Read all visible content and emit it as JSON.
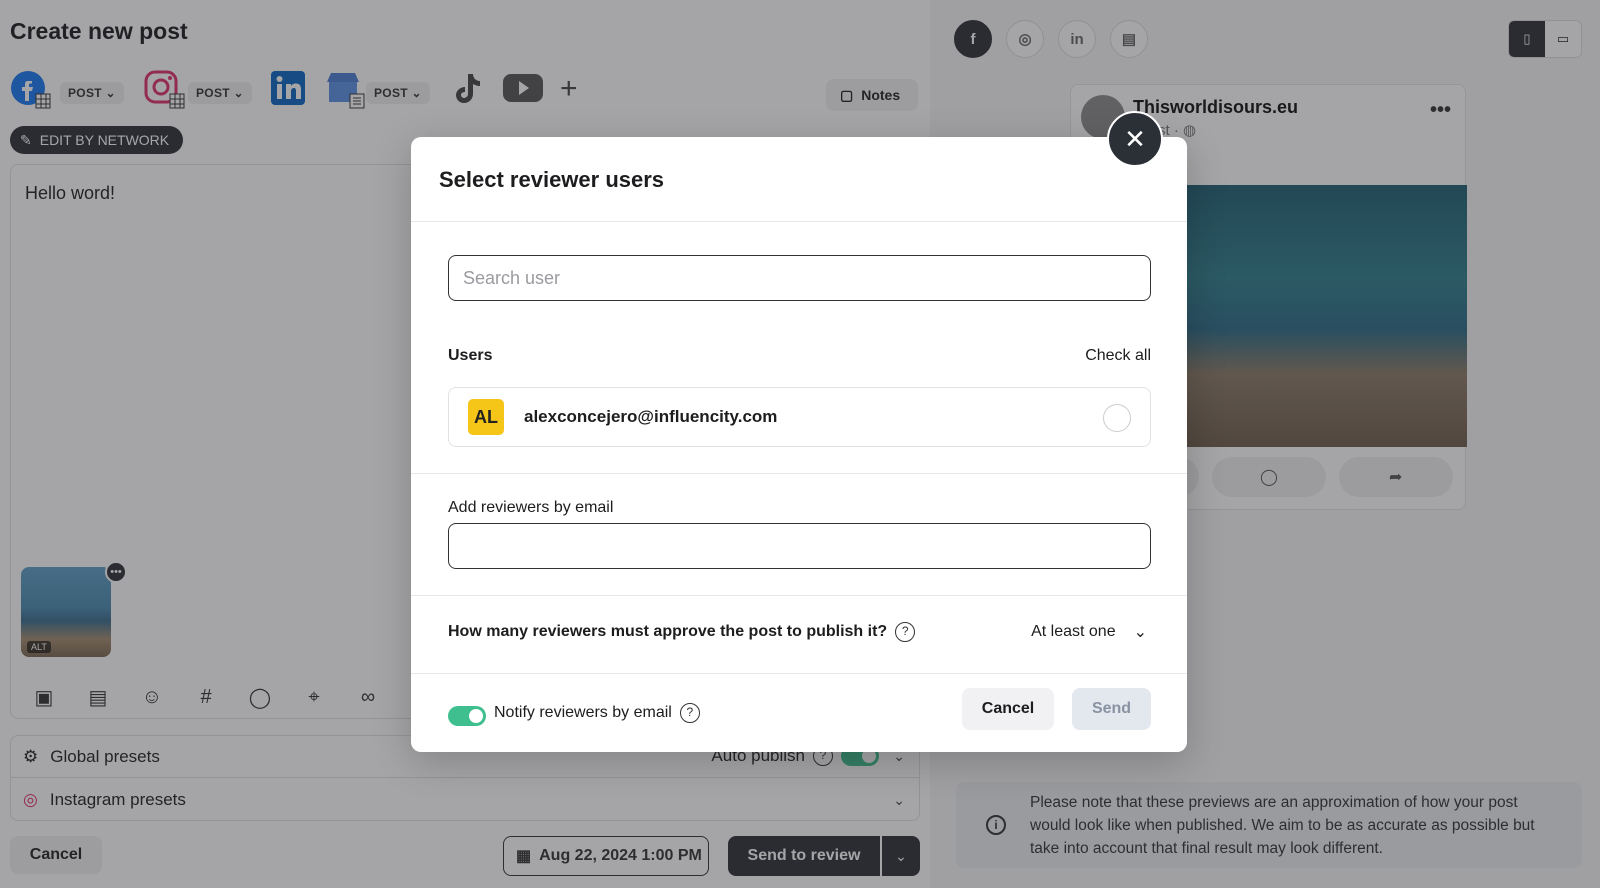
{
  "editor": {
    "title": "Create new post",
    "networks": [
      {
        "name": "facebook-icon",
        "type_label": "POST"
      },
      {
        "name": "instagram-icon",
        "type_label": "POST"
      },
      {
        "name": "linkedin-icon"
      },
      {
        "name": "google-business-icon",
        "type_label": "POST"
      },
      {
        "name": "tiktok-icon"
      },
      {
        "name": "youtube-icon"
      }
    ],
    "notes_label": "Notes",
    "edit_by_network_label": "EDIT BY NETWORK",
    "post_text": "Hello word!",
    "alt_label": "ALT",
    "presets": {
      "global_label": "Global presets",
      "instagram_label": "Instagram presets",
      "auto_publish_label": "Auto publish"
    },
    "cancel_label": "Cancel",
    "date_label": "Aug 22, 2024 1:00 PM",
    "send_to_review_label": "Send to review"
  },
  "preview": {
    "account_name": "Thisworldisours.eu",
    "account_sub": "ugust ·",
    "disclaimer": "Please note that these previews are an approximation of how your post would look like when published. We aim to be as accurate as possible but take into account that final result may look different."
  },
  "modal": {
    "title": "Select reviewer users",
    "search_placeholder": "Search user",
    "users_label": "Users",
    "check_all_label": "Check all",
    "users": [
      {
        "initials": "AL",
        "email": "alexconcejero@influencity.com"
      }
    ],
    "add_by_email_label": "Add reviewers by email",
    "approve_question": "How many reviewers must approve the post to publish it?",
    "approve_value": "At least one",
    "notify_label": "Notify reviewers by email",
    "cancel_label": "Cancel",
    "send_label": "Send"
  },
  "colors": {
    "dark": "#2b2f36",
    "toggle_on": "#3fbf8f",
    "avatar_yellow": "#f5c518",
    "send_disabled_bg": "#e3e7ee"
  }
}
